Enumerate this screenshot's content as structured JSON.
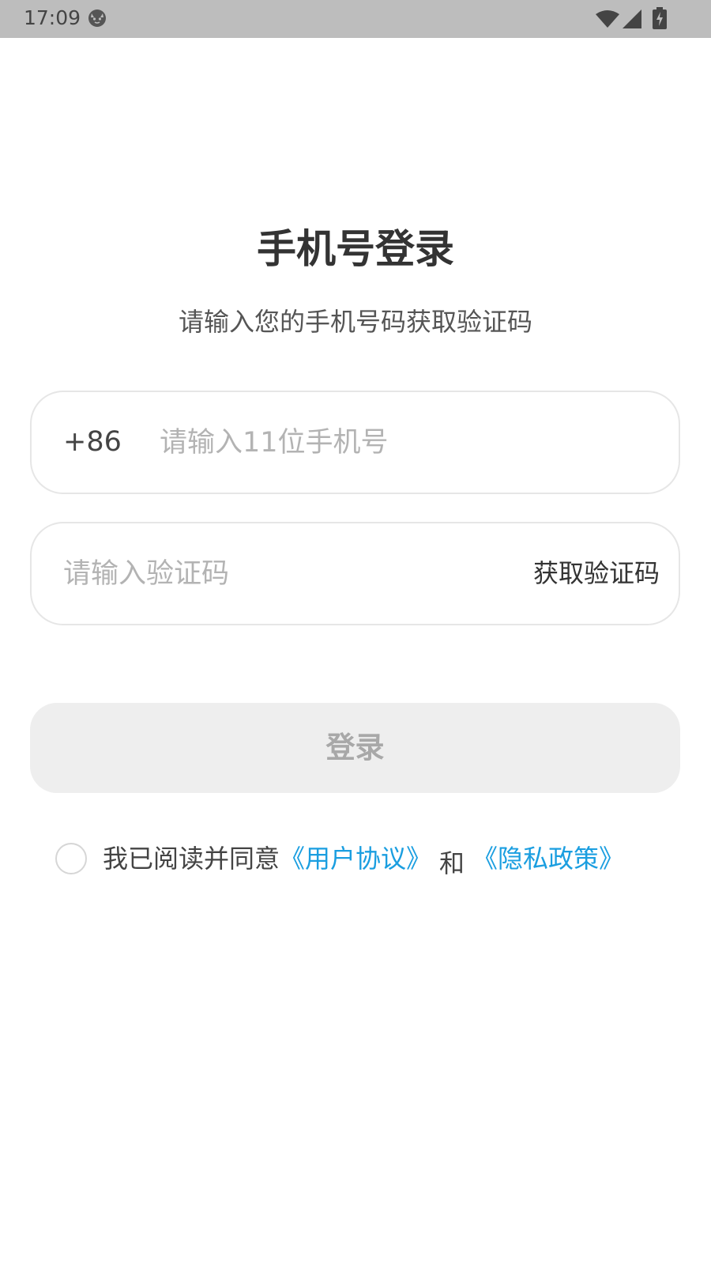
{
  "status_bar": {
    "time": "17:09",
    "background_color": "#bdbdbd"
  },
  "icons": {
    "app_notification": "cat-face-icon",
    "wifi": "wifi-icon",
    "cellular": "cellular-signal-icon",
    "battery": "battery-charging-icon"
  },
  "login": {
    "title": "手机号登录",
    "subtitle": "请输入您的手机号码获取验证码",
    "country_code": "+86",
    "phone_placeholder": "请输入11位手机号",
    "phone_value": "",
    "code_placeholder": "请输入验证码",
    "code_value": "",
    "get_code_label": "获取验证码",
    "login_button_label": "登录"
  },
  "agreement": {
    "checked": false,
    "prefix": "我已阅读并同意",
    "user_agreement": "《用户协议》",
    "conjunction": "和",
    "privacy_policy": "《隐私政策》"
  },
  "colors": {
    "link": "#1a9ee0",
    "button_disabled_bg": "#eeeeee",
    "button_disabled_text": "#a8a8a8",
    "field_border": "#e6e6e6"
  }
}
